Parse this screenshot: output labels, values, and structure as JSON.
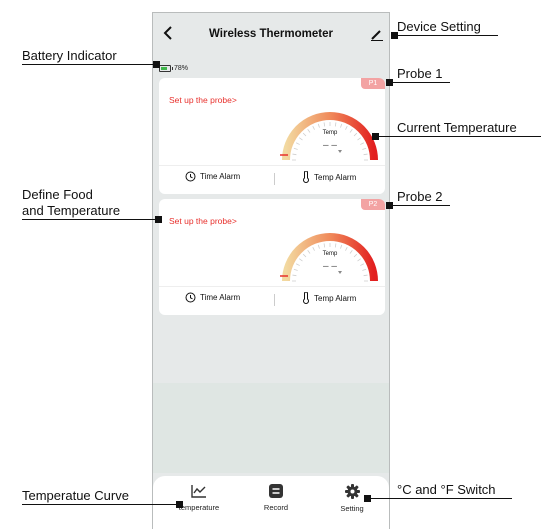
{
  "app": {
    "title": "Wireless Thermometer",
    "battery_percent": "78%",
    "battery_level": 0.78
  },
  "probes": [
    {
      "tag": "P1",
      "setup_label": "Set up the probe>",
      "gauge_label": "Temp",
      "temp_value": "– –",
      "time_alarm_label": "Time Alarm",
      "temp_alarm_label": "Temp Alarm"
    },
    {
      "tag": "P2",
      "setup_label": "Set up the probe>",
      "gauge_label": "Temp",
      "temp_value": "– –",
      "time_alarm_label": "Time Alarm",
      "temp_alarm_label": "Temp Alarm"
    }
  ],
  "nav": {
    "temperature": "temperature",
    "record": "Record",
    "setting": "Setting"
  },
  "callouts": {
    "device_setting": "Device Setting",
    "battery_indicator": "Battery Indicator",
    "probe1": "Probe 1",
    "current_temperature": "Current Temperature",
    "define_food_line1": "Define Food",
    "define_food_line2": "and Temperature",
    "probe2": "Probe 2",
    "temperature_curve": "Temperatue Curve",
    "unit_switch": "°C and °F Switch"
  },
  "colors": {
    "accent_red": "#e8302c",
    "probe_tag": "#f3a3a3",
    "battery_green": "#3fb54b",
    "gauge_start": "#f2d9a0",
    "gauge_end": "#e21f1f"
  }
}
